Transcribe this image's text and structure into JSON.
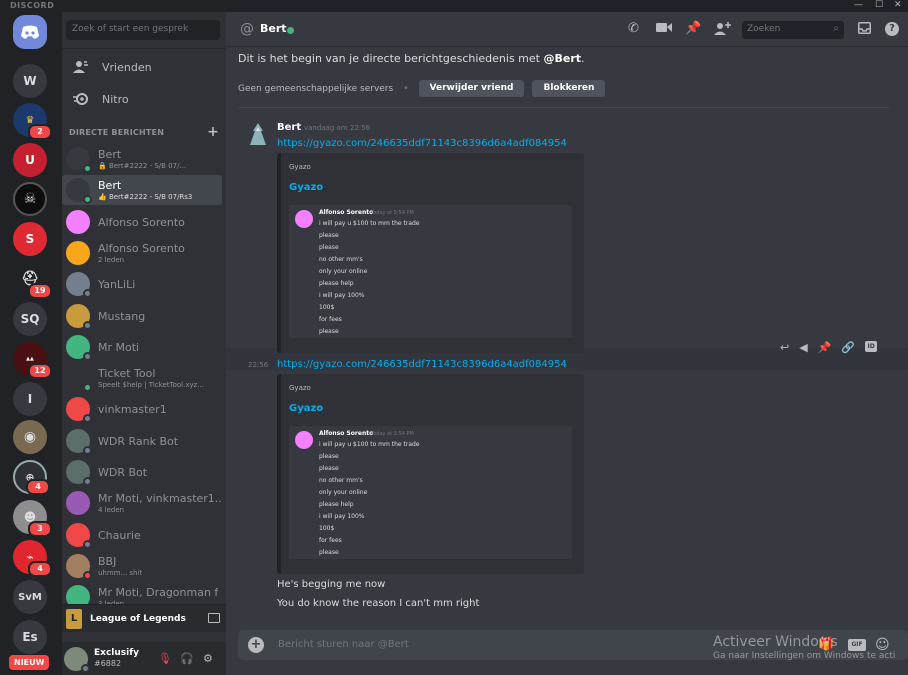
{
  "titlebar": {
    "brand": "DISCORD",
    "controls": [
      "—",
      "☐",
      "✕"
    ]
  },
  "servers": [
    {
      "kind": "home",
      "icon": "discord-logo-icon"
    },
    {
      "kind": "letter",
      "label": "W"
    },
    {
      "kind": "image",
      "color": "#1b3a6b",
      "badge": "2"
    },
    {
      "kind": "image",
      "color": "#c4202f",
      "glyph": "U"
    },
    {
      "kind": "image",
      "color": "#0d0d0d"
    },
    {
      "kind": "image",
      "color": "#e02a33",
      "glyph": "S"
    },
    {
      "kind": "image",
      "color": "#202225",
      "badge": "19"
    },
    {
      "kind": "letter",
      "label": "SQ"
    },
    {
      "kind": "image",
      "color": "#4a0f12",
      "badge": "12"
    },
    {
      "kind": "letter",
      "label": "I"
    },
    {
      "kind": "image",
      "color": "#7a6a52"
    },
    {
      "kind": "image",
      "color": "#2d3035",
      "badge": "4"
    },
    {
      "kind": "image",
      "color": "#8e8e8e",
      "badge": "3"
    },
    {
      "kind": "image",
      "color": "#e0272f",
      "badge": "4"
    },
    {
      "kind": "letter",
      "label": "SvM"
    },
    {
      "kind": "letter",
      "label": "Es"
    }
  ],
  "new_badge": "NIEUW",
  "channels": {
    "search_placeholder": "Zoek of start een gesprek",
    "nav": [
      {
        "label": "Vrienden",
        "icon": "friends-icon"
      },
      {
        "label": "Nitro",
        "icon": "nitro-icon"
      }
    ],
    "dm_header": "DIRECTE BERICHTEN",
    "dms": [
      {
        "name": "Bert",
        "sub": "🔒 Bert#2222 - S/B 07/...",
        "color": "#36393f",
        "status": "on"
      },
      {
        "name": "Bert",
        "sub": "👍 Bert#2222 - S/B 07/Rs3",
        "color": "#36393f",
        "status": "on",
        "active": true
      },
      {
        "name": "Alfonso Sorento",
        "sub": "",
        "color": "#f47fff",
        "status": ""
      },
      {
        "name": "Alfonso Sorento",
        "sub": "2 leden",
        "color": "#faa61a",
        "status": ""
      },
      {
        "name": "YanLiLi",
        "sub": "",
        "color": "#747f8d",
        "status": "off"
      },
      {
        "name": "Mustang",
        "sub": "",
        "color": "#c89b3c",
        "status": "off"
      },
      {
        "name": "Mr Moti",
        "sub": "",
        "color": "#43b581",
        "status": "off"
      },
      {
        "name": "Ticket Tool",
        "sub": "Speelt $help | TicketTool.xyz...",
        "color": "#2f3136",
        "status": "on"
      },
      {
        "name": "vinkmaster1",
        "sub": "",
        "color": "#f04747",
        "status": "off"
      },
      {
        "name": "WDR Rank Bot",
        "sub": "",
        "color": "#5b6e6a",
        "status": "off"
      },
      {
        "name": "WDR Bot",
        "sub": "",
        "color": "#5b6e6a",
        "status": "off"
      },
      {
        "name": "Mr Moti, vinkmaster1...",
        "sub": "4 leden",
        "color": "#9b59b6",
        "status": ""
      },
      {
        "name": "Chaurie",
        "sub": "",
        "color": "#f04747",
        "status": "off"
      },
      {
        "name": "BBJ",
        "sub": "uhmm... shit",
        "color": "#a08060",
        "status": "dnd"
      },
      {
        "name": "Mr Moti, Dragonman f",
        "sub": "3 leden",
        "color": "#43b581",
        "status": ""
      }
    ],
    "game_bar": "League of Legends",
    "user": {
      "name": "Exclusify",
      "tag": "#6882"
    }
  },
  "header": {
    "title": "Bert",
    "search_placeholder": "Zoeken",
    "icons": [
      "call-icon",
      "video-icon",
      "pin-icon",
      "add-friend-icon",
      "search-icon",
      "inbox-icon",
      "help-icon"
    ]
  },
  "intro": {
    "text_before": "Dit is het begin van je directe berichtgeschiedenis met ",
    "mention": "@Bert",
    "text_after": ".",
    "no_shared": "Geen gemeenschappelijke servers",
    "remove_friend": "Verwijder vriend",
    "block": "Blokkeren"
  },
  "messages": {
    "author": "Bert",
    "timestamp": "vandaag om 22:56",
    "side_time": "22:56",
    "link": "https://gyazo.com/246635ddf71143c8396d6a4adf084954",
    "embed": {
      "provider": "Gyazo",
      "title": "Gyazo",
      "shot_author": "Alfonso Sorento",
      "shot_time": "Today at 3:54 PM",
      "shot_lines": [
        "i will pay u $100 to mm the trade",
        "please",
        "please",
        "no other mm's",
        "only your online",
        "please help",
        "i will pay 100%",
        "100$",
        "for fees",
        "please"
      ]
    },
    "plain1": "He's begging me now",
    "plain2": "You do know the reason I can't mm right"
  },
  "composer": {
    "placeholder": "Bericht sturen naar @Bert",
    "gif": "GIF"
  },
  "watermark": {
    "line1": "Activeer Windows",
    "line2": "Ga naar Instellingen om Windows te acti"
  }
}
